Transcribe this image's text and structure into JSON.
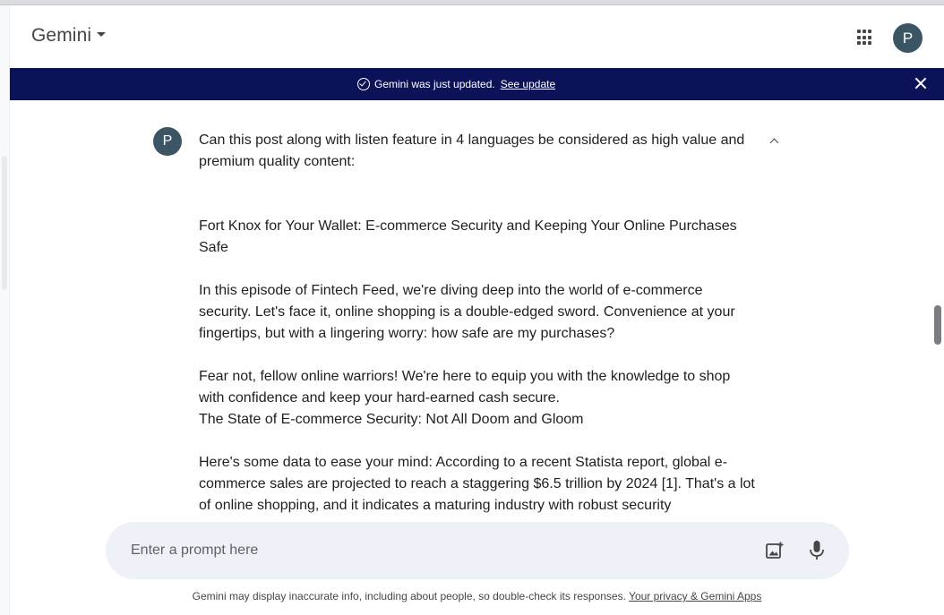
{
  "header": {
    "app_title": "Gemini",
    "avatar_initial": "P"
  },
  "banner": {
    "message": "Gemini was just updated.",
    "link_label": "See update"
  },
  "conversation": {
    "user_initial": "P",
    "prompt_lines": {
      "question": "Can this post along with listen feature in 4 languages be considered as high value and premium quality content:",
      "title": "Fort Knox for Your Wallet: E-commerce Security and Keeping Your Online Purchases Safe",
      "intro": "In this episode of Fintech Feed, we're diving deep into the world of e-commerce security. Let's face it, online shopping is a double-edged sword. Convenience at your fingertips, but with a lingering worry: how safe are my purchases?",
      "reassure": "Fear not, fellow online warriors! We're here to equip you with the knowledge to shop with confidence and keep your hard-earned cash secure.",
      "section_heading": "The State of E-commerce Security: Not All Doom and Gloom",
      "data_para": "Here's some data to ease your mind: According to a recent Statista report, global e-commerce sales are projected to reach a staggering $6.5 trillion by 2024 [1]. That's a lot of online shopping, and it indicates a maturing industry with robust security"
    }
  },
  "input": {
    "placeholder": "Enter a prompt here"
  },
  "footer": {
    "disclaimer": "Gemini may display inaccurate info, including about people, so double-check its responses.",
    "privacy_link": "Your privacy & Gemini Apps"
  },
  "colors": {
    "banner_bg": "#0b1257",
    "avatar_bg": "#3c5564",
    "prompt_box_bg": "#eef1f8"
  },
  "icons": [
    "chevron-down-icon",
    "apps-grid-icon",
    "check-circle-icon",
    "close-icon",
    "chevron-up-icon",
    "add-image-icon",
    "mic-icon"
  ]
}
